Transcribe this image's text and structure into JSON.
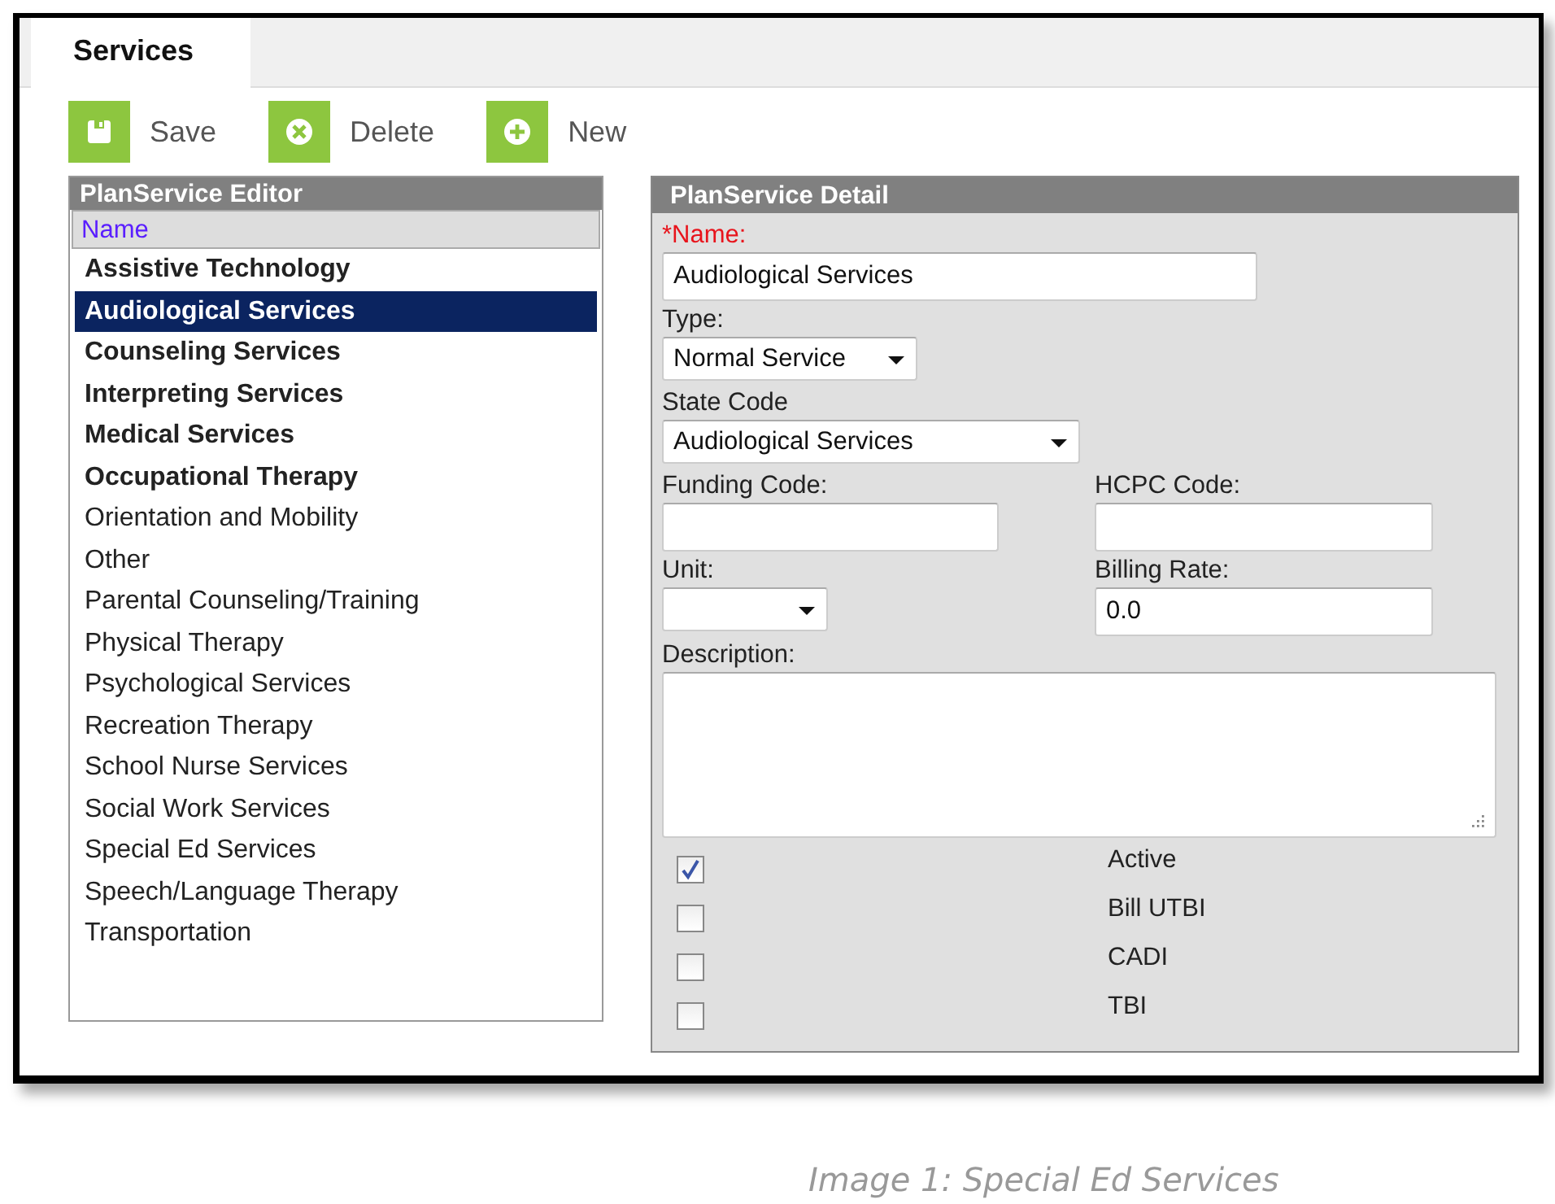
{
  "tabs": [
    {
      "label": "Services",
      "selected": true
    }
  ],
  "toolbar": [
    {
      "kind": "save",
      "label": "Save"
    },
    {
      "kind": "delete",
      "label": "Delete"
    },
    {
      "kind": "new",
      "label": "New"
    }
  ],
  "editor": {
    "title": "PlanService Editor",
    "column": "Name",
    "items": [
      {
        "name": "Assistive Technology",
        "bold": true,
        "selected": false
      },
      {
        "name": "Audiological Services",
        "bold": true,
        "selected": true
      },
      {
        "name": "Counseling Services",
        "bold": true,
        "selected": false
      },
      {
        "name": "Interpreting Services",
        "bold": true,
        "selected": false
      },
      {
        "name": "Medical Services",
        "bold": true,
        "selected": false
      },
      {
        "name": "Occupational Therapy",
        "bold": true,
        "selected": false
      },
      {
        "name": "Orientation and Mobility",
        "bold": false,
        "selected": false
      },
      {
        "name": "Other",
        "bold": false,
        "selected": false
      },
      {
        "name": "Parental Counseling/Training",
        "bold": false,
        "selected": false
      },
      {
        "name": "Physical Therapy",
        "bold": false,
        "selected": false
      },
      {
        "name": "Psychological Services",
        "bold": false,
        "selected": false
      },
      {
        "name": "Recreation Therapy",
        "bold": false,
        "selected": false
      },
      {
        "name": "School Nurse Services",
        "bold": false,
        "selected": false
      },
      {
        "name": "Social Work Services",
        "bold": false,
        "selected": false
      },
      {
        "name": "Special Ed Services",
        "bold": false,
        "selected": false
      },
      {
        "name": "Speech/Language Therapy",
        "bold": false,
        "selected": false
      },
      {
        "name": "Transportation",
        "bold": false,
        "selected": false
      }
    ]
  },
  "detail": {
    "title": "PlanService Detail",
    "rows": [
      {
        "fields": [
          {
            "label": "*Name:",
            "required": true,
            "kind": "text",
            "value": "Audiological Services"
          }
        ]
      },
      {
        "fields": [
          {
            "label": "Type:",
            "required": false,
            "kind": "select",
            "value": "Normal Service"
          }
        ]
      },
      {
        "fields": [
          {
            "label": "State Code",
            "required": false,
            "kind": "select",
            "value": "Audiological Services"
          }
        ]
      },
      {
        "fields": [
          {
            "label": "Funding Code:",
            "required": false,
            "kind": "text"
          },
          {
            "label": "HCPC Code:",
            "required": false,
            "kind": "text"
          }
        ]
      },
      {
        "fields": [
          {
            "label": "Unit:",
            "required": false,
            "kind": "select"
          },
          {
            "label": "Billing Rate:",
            "required": false,
            "kind": "text",
            "value": "0.0"
          }
        ]
      },
      {
        "fields": [
          {
            "label": "Description:",
            "required": false,
            "kind": "textarea"
          }
        ]
      }
    ],
    "options": [
      {
        "label": "Active",
        "checked": true
      },
      {
        "label": "Bill UTBI",
        "checked": false
      },
      {
        "label": "CADI",
        "checked": false
      },
      {
        "label": "TBI",
        "checked": false
      }
    ]
  },
  "caption": "Image 1: Special Ed Services"
}
